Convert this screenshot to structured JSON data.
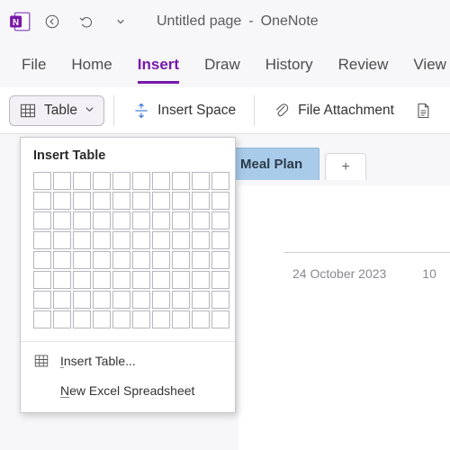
{
  "titlebar": {
    "page_title": "Untitled page",
    "dash": "-",
    "app_name": "OneNote"
  },
  "menu": {
    "file": "File",
    "home": "Home",
    "insert": "Insert",
    "draw": "Draw",
    "history": "History",
    "review": "Review",
    "view": "View"
  },
  "ribbon": {
    "table": "Table",
    "insert_space": "Insert Space",
    "file_attachment": "File Attachment"
  },
  "section_tab": {
    "label": "Meal Plan",
    "add": "+"
  },
  "page": {
    "date": "24 October 2023",
    "time_partial": "10"
  },
  "popup": {
    "title": "Insert Table",
    "insert_table": "nsert Table...",
    "insert_table_u": "I",
    "new_excel": "ew Excel Spreadsheet",
    "new_excel_u": "N"
  }
}
